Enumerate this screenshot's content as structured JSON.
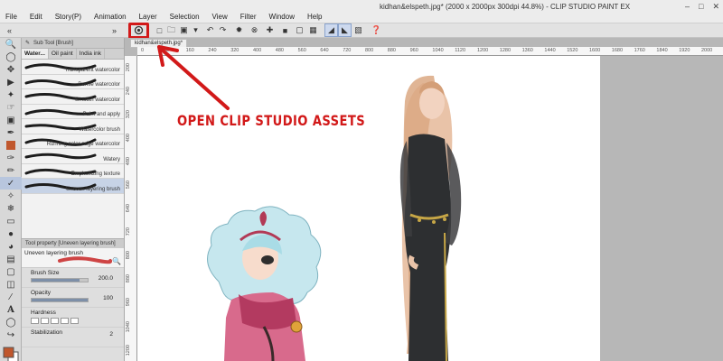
{
  "app": {
    "title": "kidhan&elspeth.jpg* (2000 x 2000px 300dpi 44.8%) - CLIP STUDIO PAINT EX"
  },
  "menu": [
    "File",
    "Edit",
    "Story(P)",
    "Animation",
    "Layer",
    "Selection",
    "View",
    "Filter",
    "Window",
    "Help"
  ],
  "document_tab": "kidhan&elspeth.jpg*",
  "sub_tool": {
    "header": "Sub Tool [Brush]",
    "tabs": [
      "Water...",
      "Oil paint",
      "India ink"
    ],
    "brushes": [
      "Transparent watercolor",
      "Dense watercolor",
      "Smooth watercolor",
      "Paint and apply",
      "Watercolor brush",
      "Running color edge watercolor",
      "Watery",
      "Emphasizing texture",
      "Uneven layering brush"
    ],
    "selected_brush": "Uneven layering brush"
  },
  "tool_property": {
    "header": "Tool property [Uneven layering brush]",
    "name": "Uneven layering brush",
    "brush_size": {
      "label": "Brush Size",
      "value": "200.0",
      "fill": 0.85
    },
    "opacity": {
      "label": "Opacity",
      "value": "100",
      "fill": 1.0
    },
    "hardness": {
      "label": "Hardness"
    },
    "stabilization": {
      "label": "Stabilization",
      "value": "2"
    }
  },
  "ruler_top": [
    "0",
    "80",
    "160",
    "240",
    "320",
    "400",
    "480",
    "560",
    "640",
    "720",
    "800",
    "880",
    "960",
    "1040",
    "1120",
    "1200",
    "1280",
    "1360",
    "1440",
    "1520",
    "1600",
    "1680",
    "1760",
    "1840",
    "1920",
    "2000"
  ],
  "ruler_left": [
    "200",
    "240",
    "320",
    "400",
    "480",
    "560",
    "640",
    "720",
    "800",
    "880",
    "960",
    "1040",
    "1200"
  ],
  "annotation": "OPEN CLIP STUDIO ASSETS",
  "colors": {
    "annotation_red": "#d21919",
    "selection_blue": "#c7d3e6"
  }
}
